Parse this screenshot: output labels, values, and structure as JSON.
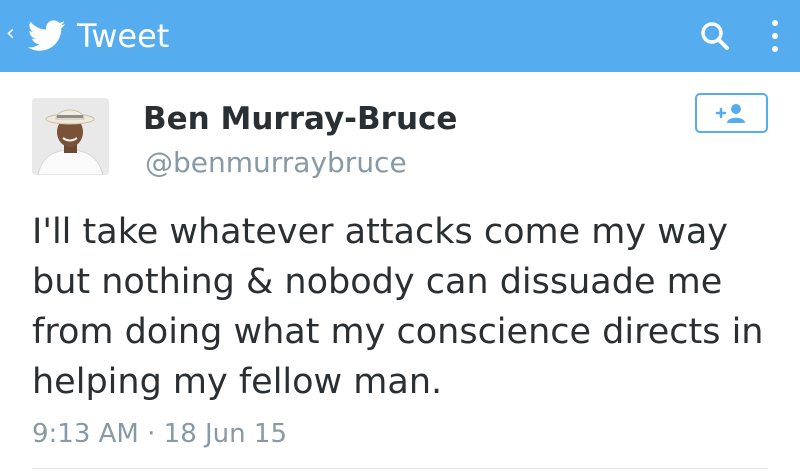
{
  "app_bar": {
    "title": "Tweet",
    "back_icon": "chevron-left-icon",
    "logo_icon": "twitter-bird-icon",
    "search_icon": "search-icon",
    "overflow_icon": "overflow-menu-icon",
    "background_color": "#55acee"
  },
  "tweet": {
    "author": {
      "display_name": "Ben Murray-Bruce",
      "handle": "@benmurraybruce",
      "avatar": "user-avatar-photo"
    },
    "follow_button": {
      "icon": "add-user-icon"
    },
    "text": "I'll take whatever attacks come my way but nothing & nobody can dissuade me from doing what my conscience directs in helping my fellow man.",
    "timestamp": "9:13 AM · 18 Jun 15"
  },
  "colors": {
    "accent": "#55acee",
    "text_primary": "#292f33",
    "text_secondary": "#8899a6"
  }
}
